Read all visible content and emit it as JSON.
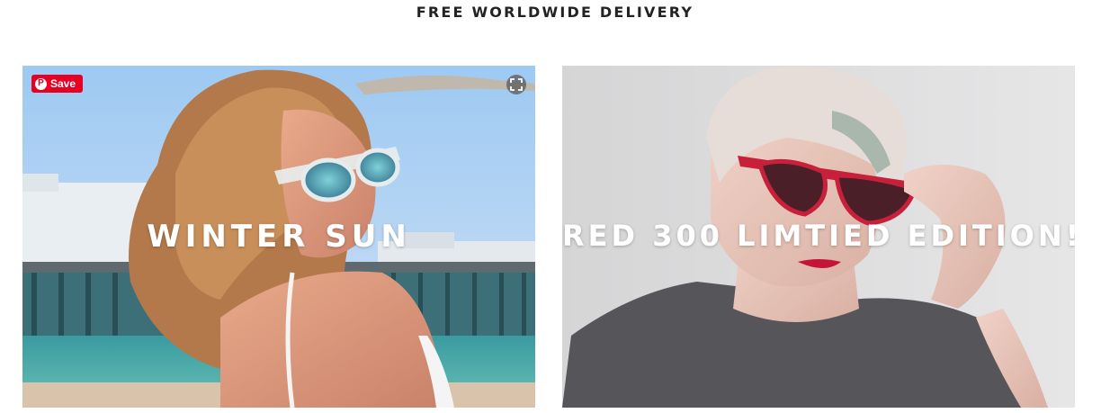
{
  "banner": {
    "text": "FREE WORLDWIDE DELIVERY"
  },
  "tiles": [
    {
      "title": "WINTER SUN",
      "image_alt": "Woman wearing clear-frame mirrored sunglasses by a seaside pier",
      "save_label": "Save"
    },
    {
      "title": "RED 300 LIMTIED EDITION!",
      "image_alt": "Woman with short platinum hair wearing red cat-eye sunglasses"
    }
  ],
  "colors": {
    "pinterest_red": "#e60023",
    "banner_text": "#222222",
    "tile_title": "#ffffff"
  },
  "icons": {
    "pinterest": "pinterest-logo-icon",
    "expand": "expand-icon"
  }
}
